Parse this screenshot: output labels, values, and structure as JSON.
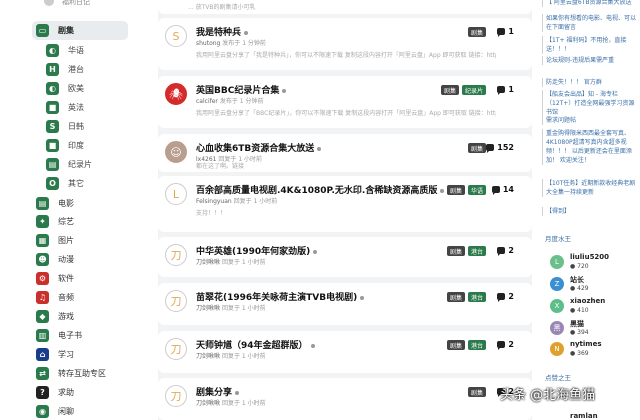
{
  "sidebar": {
    "top_label": "福利日记",
    "items": [
      {
        "label": "剧集",
        "icon": "tv-icon",
        "color": "#2b7a4b",
        "active": true
      },
      {
        "label": "华语",
        "icon": "globe-icon",
        "color": "#2b7a4b"
      },
      {
        "label": "港台",
        "icon": "h-icon",
        "color": "#2b7a4b"
      },
      {
        "label": "欧美",
        "icon": "globe-icon",
        "color": "#2b7a4b"
      },
      {
        "label": "英法",
        "icon": "book-icon",
        "color": "#2b7a4b"
      },
      {
        "label": "日韩",
        "icon": "s-icon",
        "color": "#2b7a4b"
      },
      {
        "label": "印度",
        "icon": "book-icon",
        "color": "#2b7a4b"
      },
      {
        "label": "纪录片",
        "icon": "film-icon",
        "color": "#2b7a4b"
      },
      {
        "label": "其它",
        "icon": "o-icon",
        "color": "#2b7a4b"
      },
      {
        "label": "电影",
        "icon": "film-icon",
        "color": "#2b7a4b"
      },
      {
        "label": "综艺",
        "icon": "star-icon",
        "color": "#2b7a4b"
      },
      {
        "label": "图片",
        "icon": "image-icon",
        "color": "#2b7a4b"
      },
      {
        "label": "动漫",
        "icon": "anime-icon",
        "color": "#2b7a4b"
      },
      {
        "label": "软件",
        "icon": "grid-icon",
        "color": "#c9302c"
      },
      {
        "label": "音频",
        "icon": "music-icon",
        "color": "#c9302c"
      },
      {
        "label": "游戏",
        "icon": "gamepad-icon",
        "color": "#2b7a4b"
      },
      {
        "label": "电子书",
        "icon": "ebook-icon",
        "color": "#2b7a4b"
      },
      {
        "label": "学习",
        "icon": "school-icon",
        "color": "#1a3c8c"
      },
      {
        "label": "转存互助专区",
        "icon": "share-icon",
        "color": "#2b7a4b"
      },
      {
        "label": "求助",
        "icon": "question-icon",
        "color": "#222"
      },
      {
        "label": "闲聊",
        "icon": "chat-icon",
        "color": "#2b7a4b"
      }
    ]
  },
  "main": {
    "topstrip": "... 放TVB的剧集请小可乳",
    "threads": [
      {
        "avatar": "S",
        "avatar_style": "",
        "title": "我是特种兵",
        "user": "shutong",
        "time": "发布于 1 分钟前",
        "excerpt": "我用阿里云盘分享了「我是特种兵」，你可以不限速下载 复制这段内容打开「阿里云盘」App 即可获取 链接：https://www.aliyu...",
        "tags": [
          "剧集"
        ],
        "replies": "1"
      },
      {
        "avatar": "🕷",
        "avatar_style": "spider",
        "title": "英国BBC纪录片合集",
        "user": "calcifer",
        "time": "发布于 1 分钟前",
        "excerpt": "我用阿里云盘分享了「BBC纪录片」，你可以不限速下载 复制这段内容打开「阿里云盘」App 即可获取 链接：https://www.aliyu...",
        "tags": [
          "剧集",
          "纪录片"
        ],
        "replies": "1"
      },
      {
        "avatar": "☺",
        "avatar_style": "girl",
        "title": "心血收集6TB资源合集大放送",
        "user": "lx4261",
        "time": "回复于 1 小时前",
        "excerpt": "都在这了啊。链接",
        "tags": [
          "剧集"
        ],
        "replies": "152"
      },
      {
        "avatar": "L",
        "avatar_style": "",
        "title": "百余部高质量电视剧.4K&1080P.无水印.含稀缺资源高质版",
        "user": "Felsingyuan",
        "time": "回复于 1 小时前",
        "excerpt": "支持！！！",
        "tags": [
          "剧集",
          "华语"
        ],
        "replies": "14"
      },
      {
        "avatar": "刀",
        "avatar_style": "",
        "title": "中华英雄(1990年何家劲版)",
        "user": "刀剑啾啾",
        "time": "回复于 1 小时前",
        "excerpt": "",
        "tags": [
          "剧集",
          "港台"
        ],
        "replies": "2"
      },
      {
        "avatar": "刀",
        "avatar_style": "",
        "title": "苗翠花(1996年关咏荷主演TVB电视剧)",
        "user": "刀剑啾啾",
        "time": "回复于 1 小时前",
        "excerpt": "",
        "tags": [
          "剧集",
          "港台"
        ],
        "replies": "2"
      },
      {
        "avatar": "刀",
        "avatar_style": "",
        "title": "天师钟馗（94年金超群版）",
        "user": "刀剑啾啾",
        "time": "回复于 1 小时前",
        "excerpt": "",
        "tags": [
          "剧集",
          "港台"
        ],
        "replies": "2"
      },
      {
        "avatar": "刀",
        "avatar_style": "",
        "title": "剧集分享",
        "user": "刀剑啾啾",
        "time": "回复于 1 小时前",
        "excerpt": "",
        "tags": [
          "剧集"
        ],
        "replies": "2"
      }
    ]
  },
  "right": {
    "links": [
      "【 阿里云盘6TB资源合集大放送",
      "如果你有想看的电影、电视、可以在下面留言",
      "【1T+ 福利码】不用抢，直接送！！！",
      "论坛规则-违规后果需严重",
      "防走失！！！ 官方群",
      "【船友会出品】知 - 海专栏（12T+）打造全网最强学习资源书馆",
      "需求问题帖",
      "重金购得限米西西最全套写真、4K1080P超清写真内含超多视频！！！ 以后更新还会在里面添加！ 欢迎关注！",
      "【10T任务】近期新款收经典老剧大全集一持续更新",
      "【得到】"
    ],
    "active_title": "月度水王",
    "users": [
      {
        "name": "liuliu5200",
        "score": "720",
        "avatar": "L",
        "color": "#6bbf8a"
      },
      {
        "name": "站长",
        "score": "429",
        "avatar": "Z",
        "color": "#3b8fd1"
      },
      {
        "name": "xiaozhen",
        "score": "410",
        "avatar": "X",
        "color": "#5cbf8a"
      },
      {
        "name": "黑猫",
        "score": "394",
        "avatar": "黑",
        "color": "#9a86b5"
      },
      {
        "name": "nytimes",
        "score": "369",
        "avatar": "N",
        "color": "#e0a030"
      }
    ],
    "likes_title": "点赞之王",
    "bottom_user": "ramlan"
  },
  "watermark": "头条 @北海鱼猫"
}
